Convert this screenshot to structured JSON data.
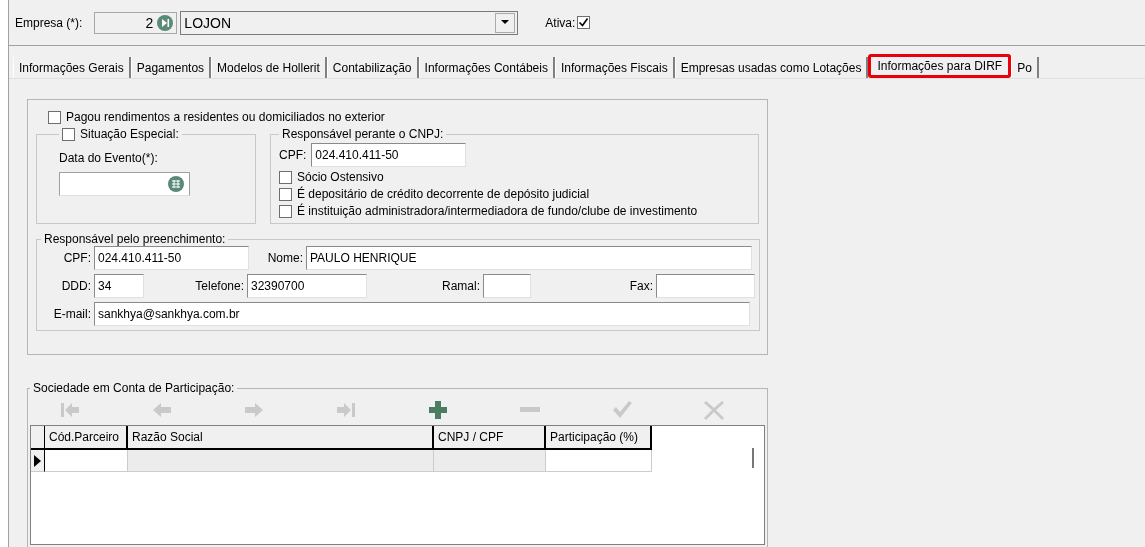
{
  "company": {
    "label": "Empresa (*):",
    "code": "2",
    "name": "LOJON",
    "active_label": "Ativa:",
    "active": true
  },
  "tabs": [
    {
      "label": "Informações Gerais",
      "selected": false,
      "highlighted": false
    },
    {
      "label": "Pagamentos",
      "selected": false,
      "highlighted": false
    },
    {
      "label": "Modelos de Hollerit",
      "selected": false,
      "highlighted": false
    },
    {
      "label": "Contabilização",
      "selected": false,
      "highlighted": false
    },
    {
      "label": "Informações Contábeis",
      "selected": false,
      "highlighted": false
    },
    {
      "label": "Informações Fiscais",
      "selected": false,
      "highlighted": false
    },
    {
      "label": "Empresas usadas como Lotações",
      "selected": false,
      "highlighted": false
    },
    {
      "label": "Informações para DIRF",
      "selected": true,
      "highlighted": true
    },
    {
      "label": "Po",
      "selected": false,
      "highlighted": false
    }
  ],
  "exterior": {
    "label": "Pagou rendimentos a residentes ou domiciliados no exterior",
    "checked": false
  },
  "situacao": {
    "label": "Situação Especial:",
    "checked": false,
    "date_label": "Data do Evento(*):"
  },
  "responsavel_cnpj": {
    "title": "Responsável perante o CNPJ:",
    "cpf_label": "CPF:",
    "cpf": "024.410.411-50",
    "options": [
      {
        "label": "Sócio Ostensivo",
        "checked": false
      },
      {
        "label": "É depositário de crédito decorrente de depósito judicial",
        "checked": false
      },
      {
        "label": "É instituição administradora/intermediadora de fundo/clube de investimento",
        "checked": false
      }
    ]
  },
  "preenchimento": {
    "title": "Responsável pelo preenchimento:",
    "cpf_label": "CPF:",
    "cpf": "024.410.411-50",
    "nome_label": "Nome:",
    "nome": "PAULO HENRIQUE",
    "ddd_label": "DDD:",
    "ddd": "34",
    "telefone_label": "Telefone:",
    "telefone": "32390700",
    "ramal_label": "Ramal:",
    "fax_label": "Fax:",
    "email_label": "E-mail:",
    "email": "sankhya@sankhya.com.br"
  },
  "sociedade": {
    "title": "Sociedade em Conta de Participação:",
    "toolbar": [
      {
        "kind": "first",
        "disabled": true
      },
      {
        "kind": "prev",
        "disabled": true
      },
      {
        "kind": "next",
        "disabled": true
      },
      {
        "kind": "last",
        "disabled": true
      },
      {
        "kind": "add",
        "disabled": false
      },
      {
        "kind": "remove",
        "disabled": true
      },
      {
        "kind": "confirm",
        "disabled": true
      },
      {
        "kind": "cancel",
        "disabled": true
      }
    ],
    "columns": [
      {
        "label": "Cód.Parceiro",
        "readonly": false
      },
      {
        "label": "Razão Social",
        "readonly": true
      },
      {
        "label": "CNPJ / CPF",
        "readonly": true
      },
      {
        "label": "Participação (%)",
        "readonly": false
      }
    ],
    "rows": [
      {
        "current": true
      }
    ]
  }
}
